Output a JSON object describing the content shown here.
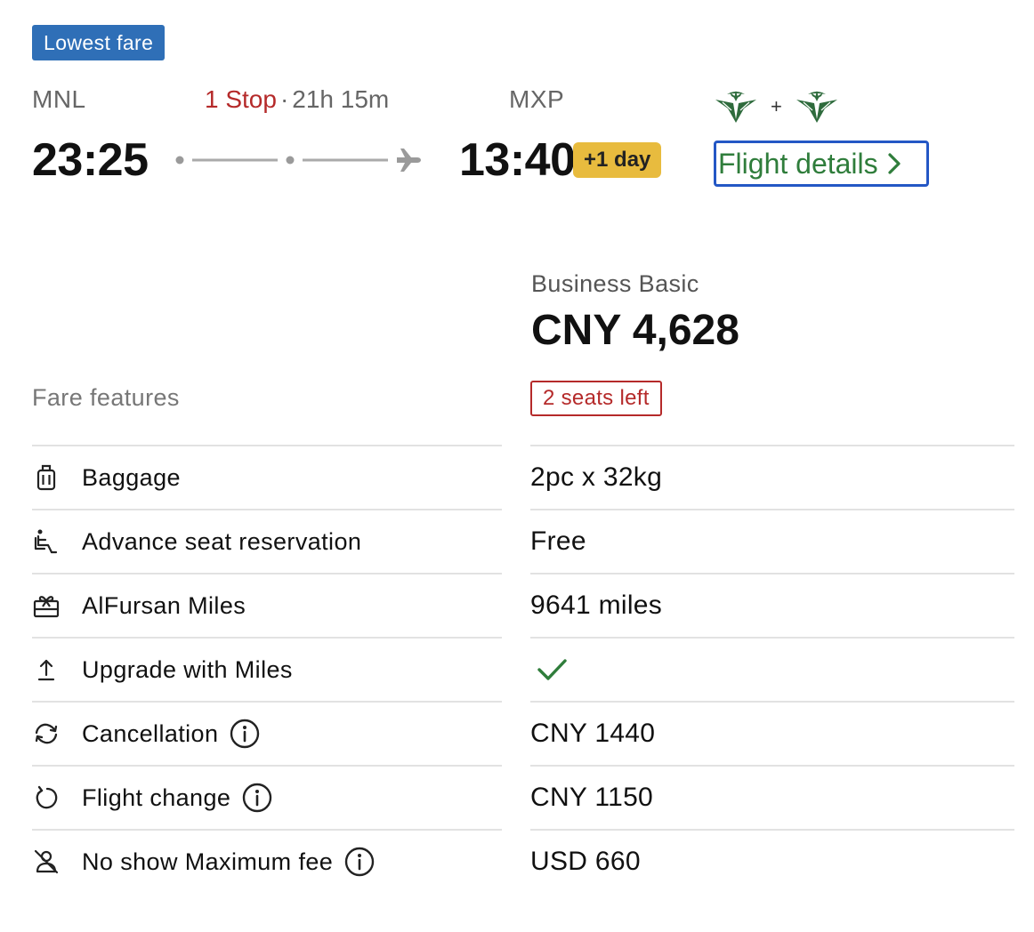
{
  "badge": "Lowest fare",
  "itinerary": {
    "origin_code": "MNL",
    "destination_code": "MXP",
    "stop_count": "1 Stop",
    "separator": "·",
    "duration": "21h 15m",
    "departure_time": "23:25",
    "arrival_time": "13:40",
    "day_offset": "+1 day",
    "airlines_plus": "+",
    "flight_details_label": "Flight details"
  },
  "fare": {
    "name": "Business Basic",
    "price": "CNY 4,628",
    "seats_left": "2 seats left"
  },
  "features_title": "Fare features",
  "features": [
    {
      "label": "Baggage",
      "value": "2pc x 32kg",
      "icon": "baggage-icon"
    },
    {
      "label": "Advance seat reservation",
      "value": "Free",
      "icon": "seat-icon"
    },
    {
      "label": "AlFursan Miles",
      "value": "9641 miles",
      "icon": "gift-icon"
    },
    {
      "label": "Upgrade with Miles",
      "value": "",
      "icon": "upgrade-icon",
      "included": true
    },
    {
      "label": "Cancellation",
      "value": "CNY 1440",
      "icon": "refresh-icon",
      "info": true
    },
    {
      "label": "Flight change",
      "value": "CNY 1150",
      "icon": "rotate-icon",
      "info": true
    },
    {
      "label": "No show Maximum fee",
      "value": "USD 660",
      "icon": "no-show-icon",
      "info": true
    }
  ],
  "colors": {
    "badge_blue": "#2f6fb7",
    "stop_red": "#b52a2a",
    "day_yellow": "#e8bb3e",
    "details_green": "#2f7d3b",
    "focus_blue": "#2457c5",
    "airline_green": "#2e6b3c"
  }
}
